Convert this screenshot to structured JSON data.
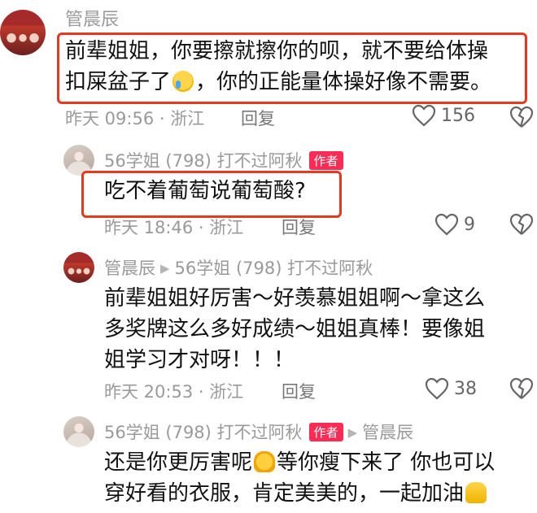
{
  "comments": [
    {
      "name": "管晨辰",
      "content_line1": "前辈姐姐，你要擦就擦你的呗，就不要给体操",
      "content_line2a": "扣屎盆子了",
      "content_line2_emoji": "crying-emoji",
      "content_line2b": "，你的正能量体操好像不需要。",
      "time": "昨天 09:56 · 浙江",
      "reply_label": "回复",
      "likes": "156"
    },
    {
      "name": "56学姐 (798) 打不过阿秋",
      "author_badge": "作者",
      "content": "吃不着葡萄说葡萄酸?",
      "time": "昨天 18:46 · 浙江",
      "reply_label": "回复",
      "likes": "9"
    },
    {
      "name": "管晨辰",
      "reply_to": "56学姐 (798) 打不过阿秋",
      "content_line1": "前辈姐姐好厉害～好羡慕姐姐啊～拿这么",
      "content_line2": "多奖牌这么多好成绩～姐姐真棒！要像姐",
      "content_line3": "姐学习才对呀！！！",
      "time": "昨天 20:53 · 浙江",
      "reply_label": "回复",
      "likes": "38"
    },
    {
      "name": "56学姐 (798) 打不过阿秋",
      "author_badge": "作者",
      "reply_to": "管晨辰",
      "content_line1a": "还是你更厉害呢",
      "content_line1_emoji": "strong-emoji",
      "content_line1b": "等你瘦下来了 你也可以",
      "content_line2a": "穿好看的衣服，肯定美美的，一起加油",
      "content_line2_emoji": "pray-emoji"
    }
  ],
  "colors": {
    "highlight": "#e53a1f",
    "author_badge": "#fe2c55"
  }
}
